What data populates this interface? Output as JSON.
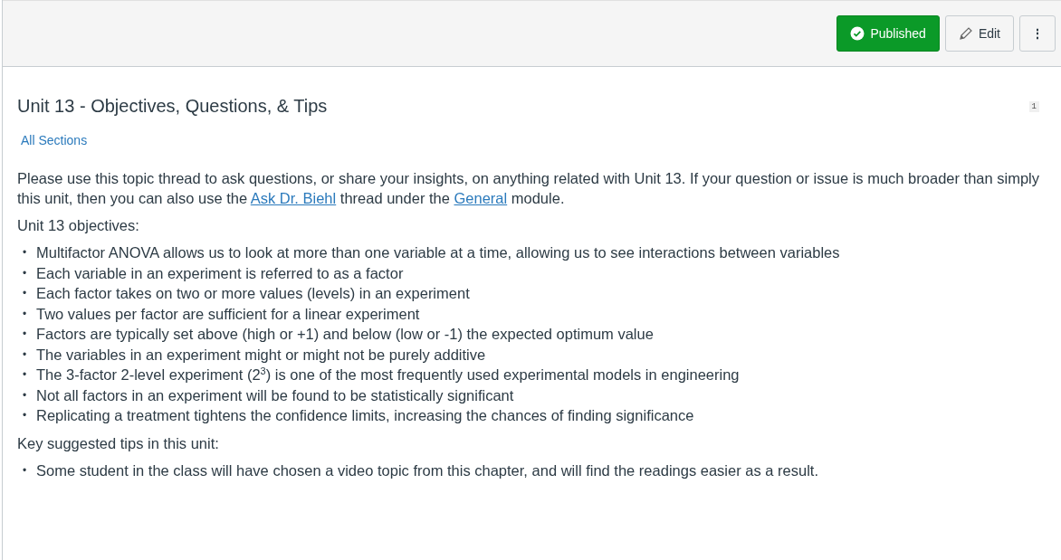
{
  "toolbar": {
    "buttons": [
      {
        "kind": "publish",
        "label": "Published",
        "published": true
      },
      {
        "kind": "edit",
        "label": "Edit"
      },
      {
        "kind": "more",
        "label": "⋮"
      }
    ]
  },
  "topic": {
    "title": "Unit 13 - Objectives, Questions, & Tips",
    "reply_count": "1",
    "sections_link": "All Sections",
    "intro": [
      {
        "kind": "text",
        "text": "Please use this topic thread to ask questions, or share your insights, on anything related with Unit 13. If your question or issue is much broader than simply this unit, then you can also use the "
      },
      {
        "kind": "link",
        "text": "Ask Dr. Biehl"
      },
      {
        "kind": "text",
        "text": " thread under the "
      },
      {
        "kind": "link",
        "text": "General"
      },
      {
        "kind": "text",
        "text": " module."
      }
    ],
    "sections": [
      {
        "heading": "Unit 13 objectives:",
        "items": [
          {
            "bullet": "•",
            "text": "Multifactor ANOVA allows us to look at more than one variable at a time, allowing us to see interactions between variables"
          },
          {
            "bullet": "•",
            "text": "Each variable in an experiment is referred to as a factor"
          },
          {
            "bullet": "•",
            "text": "Each factor takes on two or more values (levels) in an experiment"
          },
          {
            "bullet": "•",
            "text": "Two values per factor are sufficient for a linear experiment"
          },
          {
            "bullet": "•",
            "text": "Factors are typically set above (high or +1) and below (low or -1) the expected optimum value"
          },
          {
            "bullet": "•",
            "text": "The variables in an experiment might or might not be purely additive"
          },
          {
            "bullet": "•",
            "text": "The 3-factor 2-level experiment (2$^{3}$) is one of the most frequently used experimental models in engineering"
          },
          {
            "bullet": "•",
            "text": "Not all factors in an experiment will be found to be statistically significant"
          },
          {
            "bullet": "•",
            "text": "Replicating a treatment tightens the confidence limits, increasing the chances of finding significance"
          }
        ]
      },
      {
        "heading": "Key suggested tips in this unit:",
        "items": [
          {
            "bullet": "•",
            "text": "Some student in the class will have chosen a video topic from this chapter, and will find the readings easier as a result."
          }
        ]
      }
    ]
  }
}
